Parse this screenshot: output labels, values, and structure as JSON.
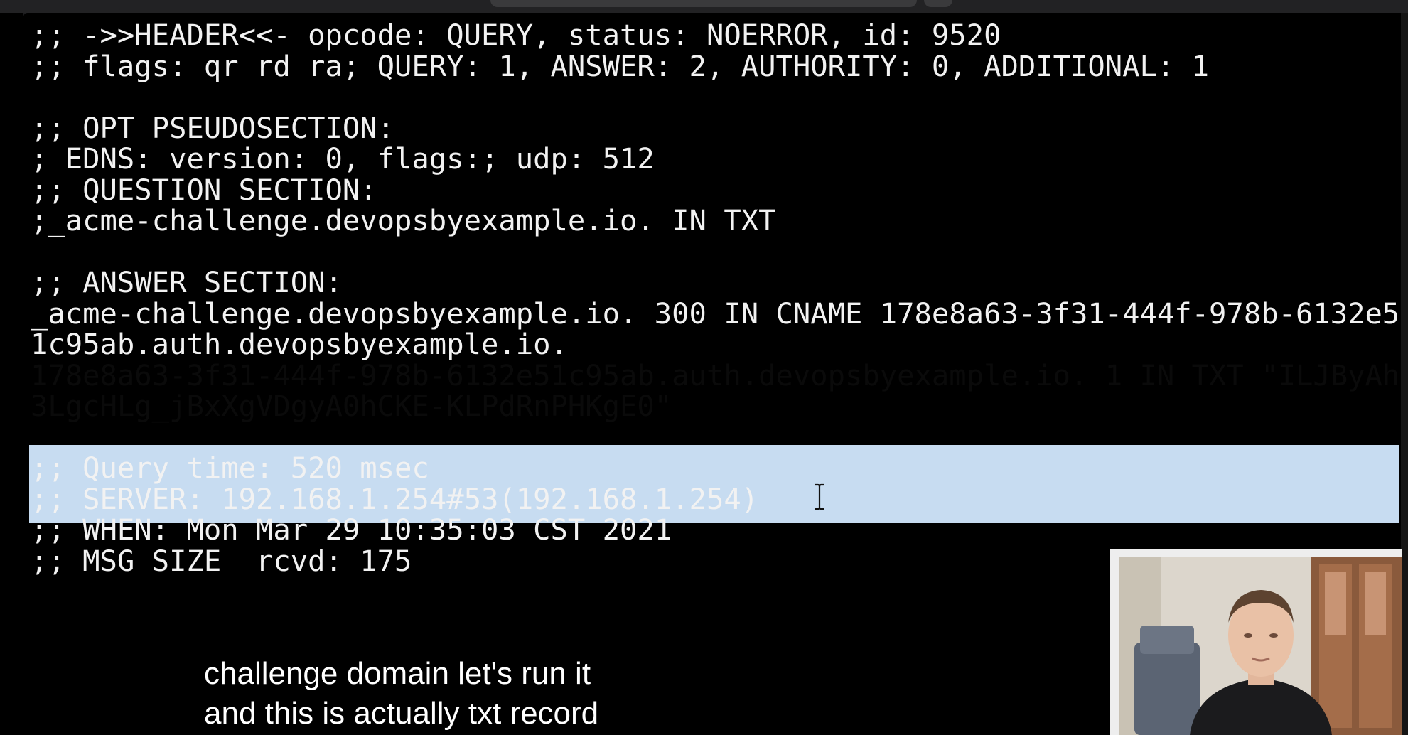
{
  "terminal": {
    "lines_before": [
      ";; ->>HEADER<<- opcode: QUERY, status: NOERROR, id: 9520",
      ";; flags: qr rd ra; QUERY: 1, ANSWER: 2, AUTHORITY: 0, ADDITIONAL: 1",
      "",
      ";; OPT PSEUDOSECTION:",
      "; EDNS: version: 0, flags:; udp: 512",
      ";; QUESTION SECTION:",
      ";_acme-challenge.devopsbyexample.io. IN TXT",
      "",
      ";; ANSWER SECTION:",
      "_acme-challenge.devopsbyexample.io. 300 IN CNAME 178e8a63-3f31-444f-978b-6132e5",
      "1c95ab.auth.devopsbyexample.io."
    ],
    "selected_lines": [
      "178e8a63-3f31-444f-978b-6132e51c95ab.auth.devopsbyexample.io. 1 IN TXT \"ILJByAh",
      "3LgcHLg_jBxXgVDgyA0hCKE-KLPdRnPHKgE0\""
    ],
    "lines_after": [
      "",
      ";; Query time: 520 msec",
      ";; SERVER: 192.168.1.254#53(192.168.1.254)",
      ";; WHEN: Mon Mar 29 10:35:03 CST 2021",
      ";; MSG SIZE  rcvd: 175"
    ]
  },
  "caption": {
    "line1": "challenge domain let's run it",
    "line2": "and this is actually txt record"
  },
  "colors": {
    "terminal_bg": "#000000",
    "terminal_text": "#f2f2f2",
    "selection_bg": "#c7dcf1"
  },
  "icons": {
    "cursor": "text-cursor-ibeam-icon",
    "webcam": "presenter-webcam"
  }
}
